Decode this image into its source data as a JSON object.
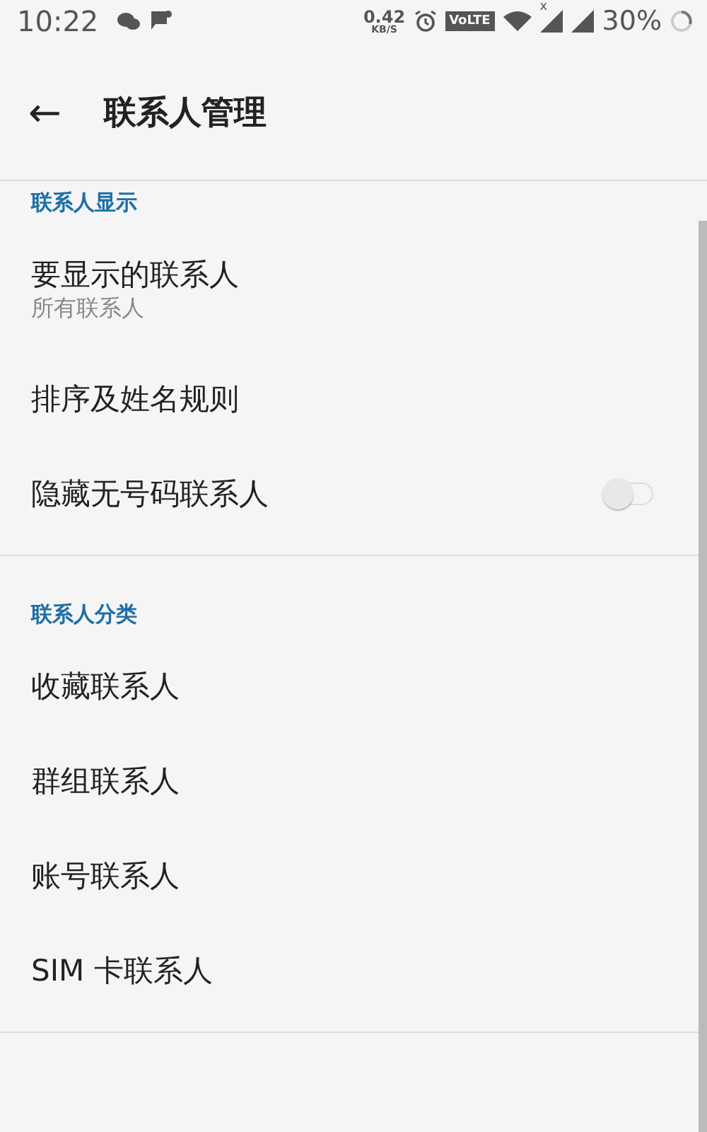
{
  "status_bar": {
    "time": "10:22",
    "speed": "0.42",
    "speed_unit": "KB/S",
    "volte": "VoLTE",
    "sim_x": "x",
    "battery": "30%"
  },
  "app_bar": {
    "back": "←",
    "title": "联系人管理"
  },
  "sections": [
    {
      "header": "联系人显示",
      "items": [
        {
          "kind": "summary",
          "title": "要显示的联系人",
          "summary": "所有联系人"
        },
        {
          "kind": "plain",
          "title": "排序及姓名规则"
        },
        {
          "kind": "toggle",
          "title": "隐藏无号码联系人",
          "on": false
        }
      ]
    },
    {
      "header": "联系人分类",
      "items": [
        {
          "kind": "plain",
          "title": "收藏联系人"
        },
        {
          "kind": "plain",
          "title": "群组联系人"
        },
        {
          "kind": "plain",
          "title": "账号联系人"
        },
        {
          "kind": "plain",
          "title": "SIM 卡联系人"
        }
      ]
    }
  ]
}
